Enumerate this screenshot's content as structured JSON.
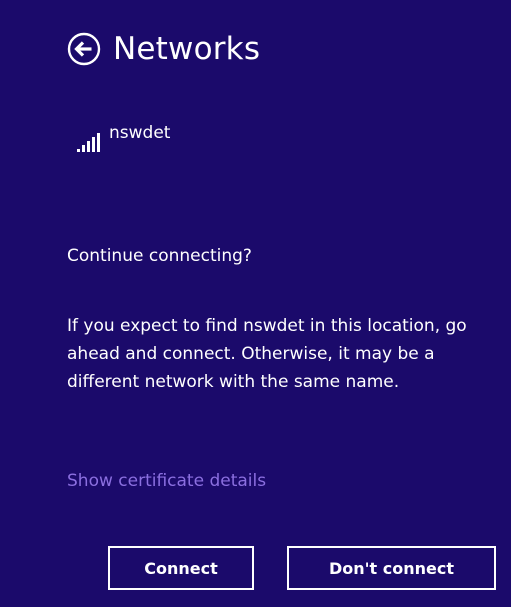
{
  "header": {
    "title": "Networks",
    "back_icon": "back-arrow-circle-icon"
  },
  "network": {
    "name": "nswdet",
    "signal_icon": "wifi-signal-icon",
    "signal_level": 5
  },
  "dialog": {
    "prompt": "Continue connecting?",
    "message": "If you expect to find nswdet in this location, go ahead and connect. Otherwise, it may be a different network with the same name.",
    "certificate_link": "Show certificate details"
  },
  "buttons": {
    "connect_label": "Connect",
    "dont_connect_label": "Don't connect"
  },
  "colors": {
    "background": "#1b0a6b",
    "text": "#ffffff",
    "link": "#8b6fe0"
  }
}
